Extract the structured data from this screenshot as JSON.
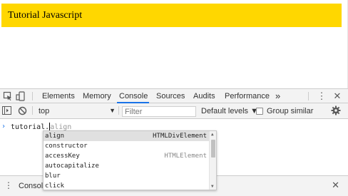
{
  "page": {
    "banner_text": "Tutorial Javascript",
    "banner_color": "#ffd700"
  },
  "devtools": {
    "tabs": [
      {
        "label": "Elements"
      },
      {
        "label": "Memory"
      },
      {
        "label": "Console",
        "active": true
      },
      {
        "label": "Sources"
      },
      {
        "label": "Audits"
      },
      {
        "label": "Performance"
      }
    ],
    "more_tabs_label": "»",
    "toolbar": {
      "context_value": "top",
      "filter_placeholder": "Filter",
      "levels_label": "Default levels ▼",
      "group_similar_label": "Group similar",
      "group_similar_checked": false
    },
    "prompt": {
      "typed": "tutorial.",
      "ghost": "align"
    },
    "autocomplete": [
      {
        "name": "align",
        "type": "HTMLDivElement",
        "selected": true
      },
      {
        "name": "constructor",
        "type": ""
      },
      {
        "name": "accessKey",
        "type": "HTMLElement"
      },
      {
        "name": "autocapitalize",
        "type": ""
      },
      {
        "name": "blur",
        "type": ""
      },
      {
        "name": "click",
        "type": ""
      }
    ],
    "drawer": {
      "tab_label": "Console"
    },
    "accent_color": "#1a73e8"
  }
}
